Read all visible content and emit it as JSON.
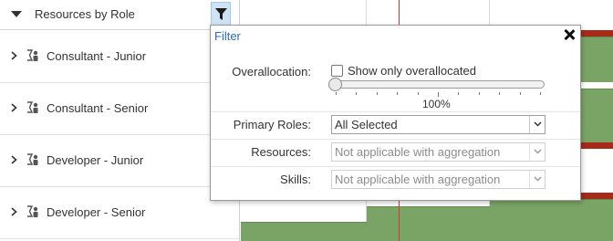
{
  "left_panel": {
    "header_title": "Resources by Role",
    "rows": [
      {
        "label": "Consultant - Junior"
      },
      {
        "label": "Consultant - Senior"
      },
      {
        "label": "Developer - Junior"
      },
      {
        "label": "Developer - Senior"
      }
    ]
  },
  "filter_popup": {
    "title": "Filter",
    "overallocation": {
      "label": "Overallocation:",
      "checkbox_label": "Show only overallocated",
      "checked": false,
      "slider_value": "100%"
    },
    "primary_roles": {
      "label": "Primary Roles:",
      "value": "All Selected"
    },
    "resources": {
      "label": "Resources:",
      "value": "Not applicable with aggregation"
    },
    "skills": {
      "label": "Skills:",
      "value": "Not applicable with aggregation"
    }
  },
  "colors": {
    "allocation_bar": "#7aa466",
    "overallocation_bar": "#a52a1a",
    "today_line": "#d23b2b",
    "filter_button_active": "#cfe3f6",
    "popup_title": "#2f6db5"
  },
  "icons": {
    "header_caret": "caret-down-icon",
    "filter_button": "funnel-icon",
    "row_expand": "chevron-right-icon",
    "row_role": "role-group-icon",
    "popup_close": "close-icon",
    "select_arrow": "chevron-down-icon"
  }
}
